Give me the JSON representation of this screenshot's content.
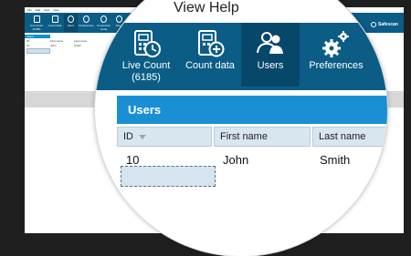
{
  "background_window": {
    "menu": [
      "File",
      "Edit",
      "View",
      "Help"
    ],
    "toolbar": [
      {
        "label": "Live Count (6185)",
        "active": false
      },
      {
        "label": "Count data",
        "active": false
      },
      {
        "label": "Users",
        "active": true
      },
      {
        "label": "Preferences",
        "active": false
      },
      {
        "label": "Connection mode",
        "active": false
      },
      {
        "label": "About",
        "active": false
      }
    ],
    "brand": "Safescan",
    "panel_title": "Users",
    "columns": [
      "ID",
      "First name",
      "Last name"
    ],
    "rows": [
      {
        "id": "10",
        "first_name": "John",
        "last_name": "Smith"
      }
    ]
  },
  "magnifier": {
    "menu_fragment": "View   Help",
    "toolbar": [
      {
        "icon": "live-count-icon",
        "label_line1": "Live Count",
        "label_line2": "(6185)",
        "active": false
      },
      {
        "icon": "count-data-icon",
        "label_line1": "Count data",
        "label_line2": "",
        "active": false
      },
      {
        "icon": "users-icon",
        "label_line1": "Users",
        "label_line2": "",
        "active": true
      },
      {
        "icon": "preferences-icon",
        "label_line1": "Preferences",
        "label_line2": "",
        "active": false
      }
    ],
    "panel_title": "Users",
    "columns": [
      "ID",
      "First name",
      "Last name"
    ],
    "rows": [
      {
        "id": "10",
        "first_name": "John",
        "last_name": "Smith"
      }
    ]
  },
  "colors": {
    "toolbar": "#0b5d86",
    "toolbar_active": "#07486a",
    "panel_title": "#1a8fd4",
    "column_header": "#d8e6f0"
  }
}
